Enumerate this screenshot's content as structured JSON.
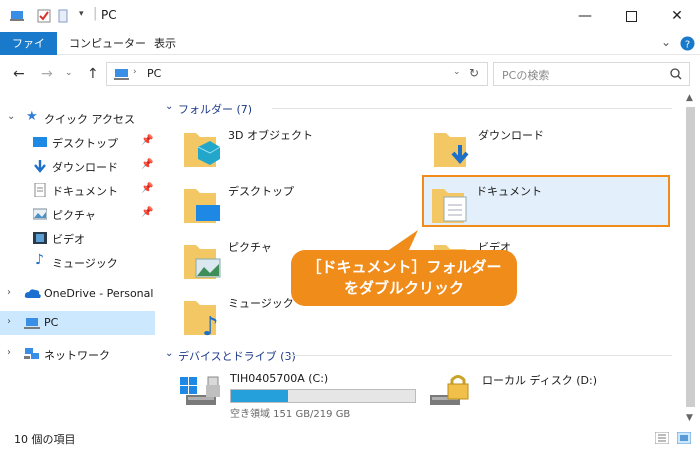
{
  "window": {
    "title": "PC",
    "minimize_icon": "minimize-icon",
    "maximize_icon": "maximize-icon",
    "close_icon": "close-icon"
  },
  "ribbon": {
    "tabs": [
      "ファイル",
      "コンピューター",
      "表示"
    ],
    "active_tab_color": "#1979ca"
  },
  "address": {
    "path": "PC",
    "search_placeholder": "PCの検索"
  },
  "nav": {
    "quick_access": "クイック アクセス",
    "quick_items": [
      {
        "label": "デスクトップ",
        "pinned": true
      },
      {
        "label": "ダウンロード",
        "pinned": true
      },
      {
        "label": "ドキュメント",
        "pinned": true
      },
      {
        "label": "ピクチャ",
        "pinned": true
      },
      {
        "label": "ビデオ",
        "pinned": false
      },
      {
        "label": "ミュージック",
        "pinned": false
      }
    ],
    "onedrive": "OneDrive - Personal",
    "pc": "PC",
    "network": "ネットワーク"
  },
  "content": {
    "folders_group": "フォルダー (7)",
    "folders": [
      {
        "label": "3D オブジェクト"
      },
      {
        "label": "ダウンロード"
      },
      {
        "label": "デスクトップ"
      },
      {
        "label": "ドキュメント"
      },
      {
        "label": "ピクチャ"
      },
      {
        "label": "ビデオ"
      },
      {
        "label": "ミュージック"
      }
    ],
    "drives_group": "デバイスとドライブ (3)",
    "drives": [
      {
        "label": "TIH0405700A (C:)",
        "free_text": "空き領域 151 GB/219 GB",
        "used_fraction": 0.31
      },
      {
        "label": "ローカル ディスク (D:)"
      }
    ]
  },
  "status": {
    "item_count": "10 個の項目"
  },
  "callout": {
    "line1": "［ドキュメント］フォルダー",
    "line2": "をダブルクリック",
    "color": "#f08c1a"
  }
}
